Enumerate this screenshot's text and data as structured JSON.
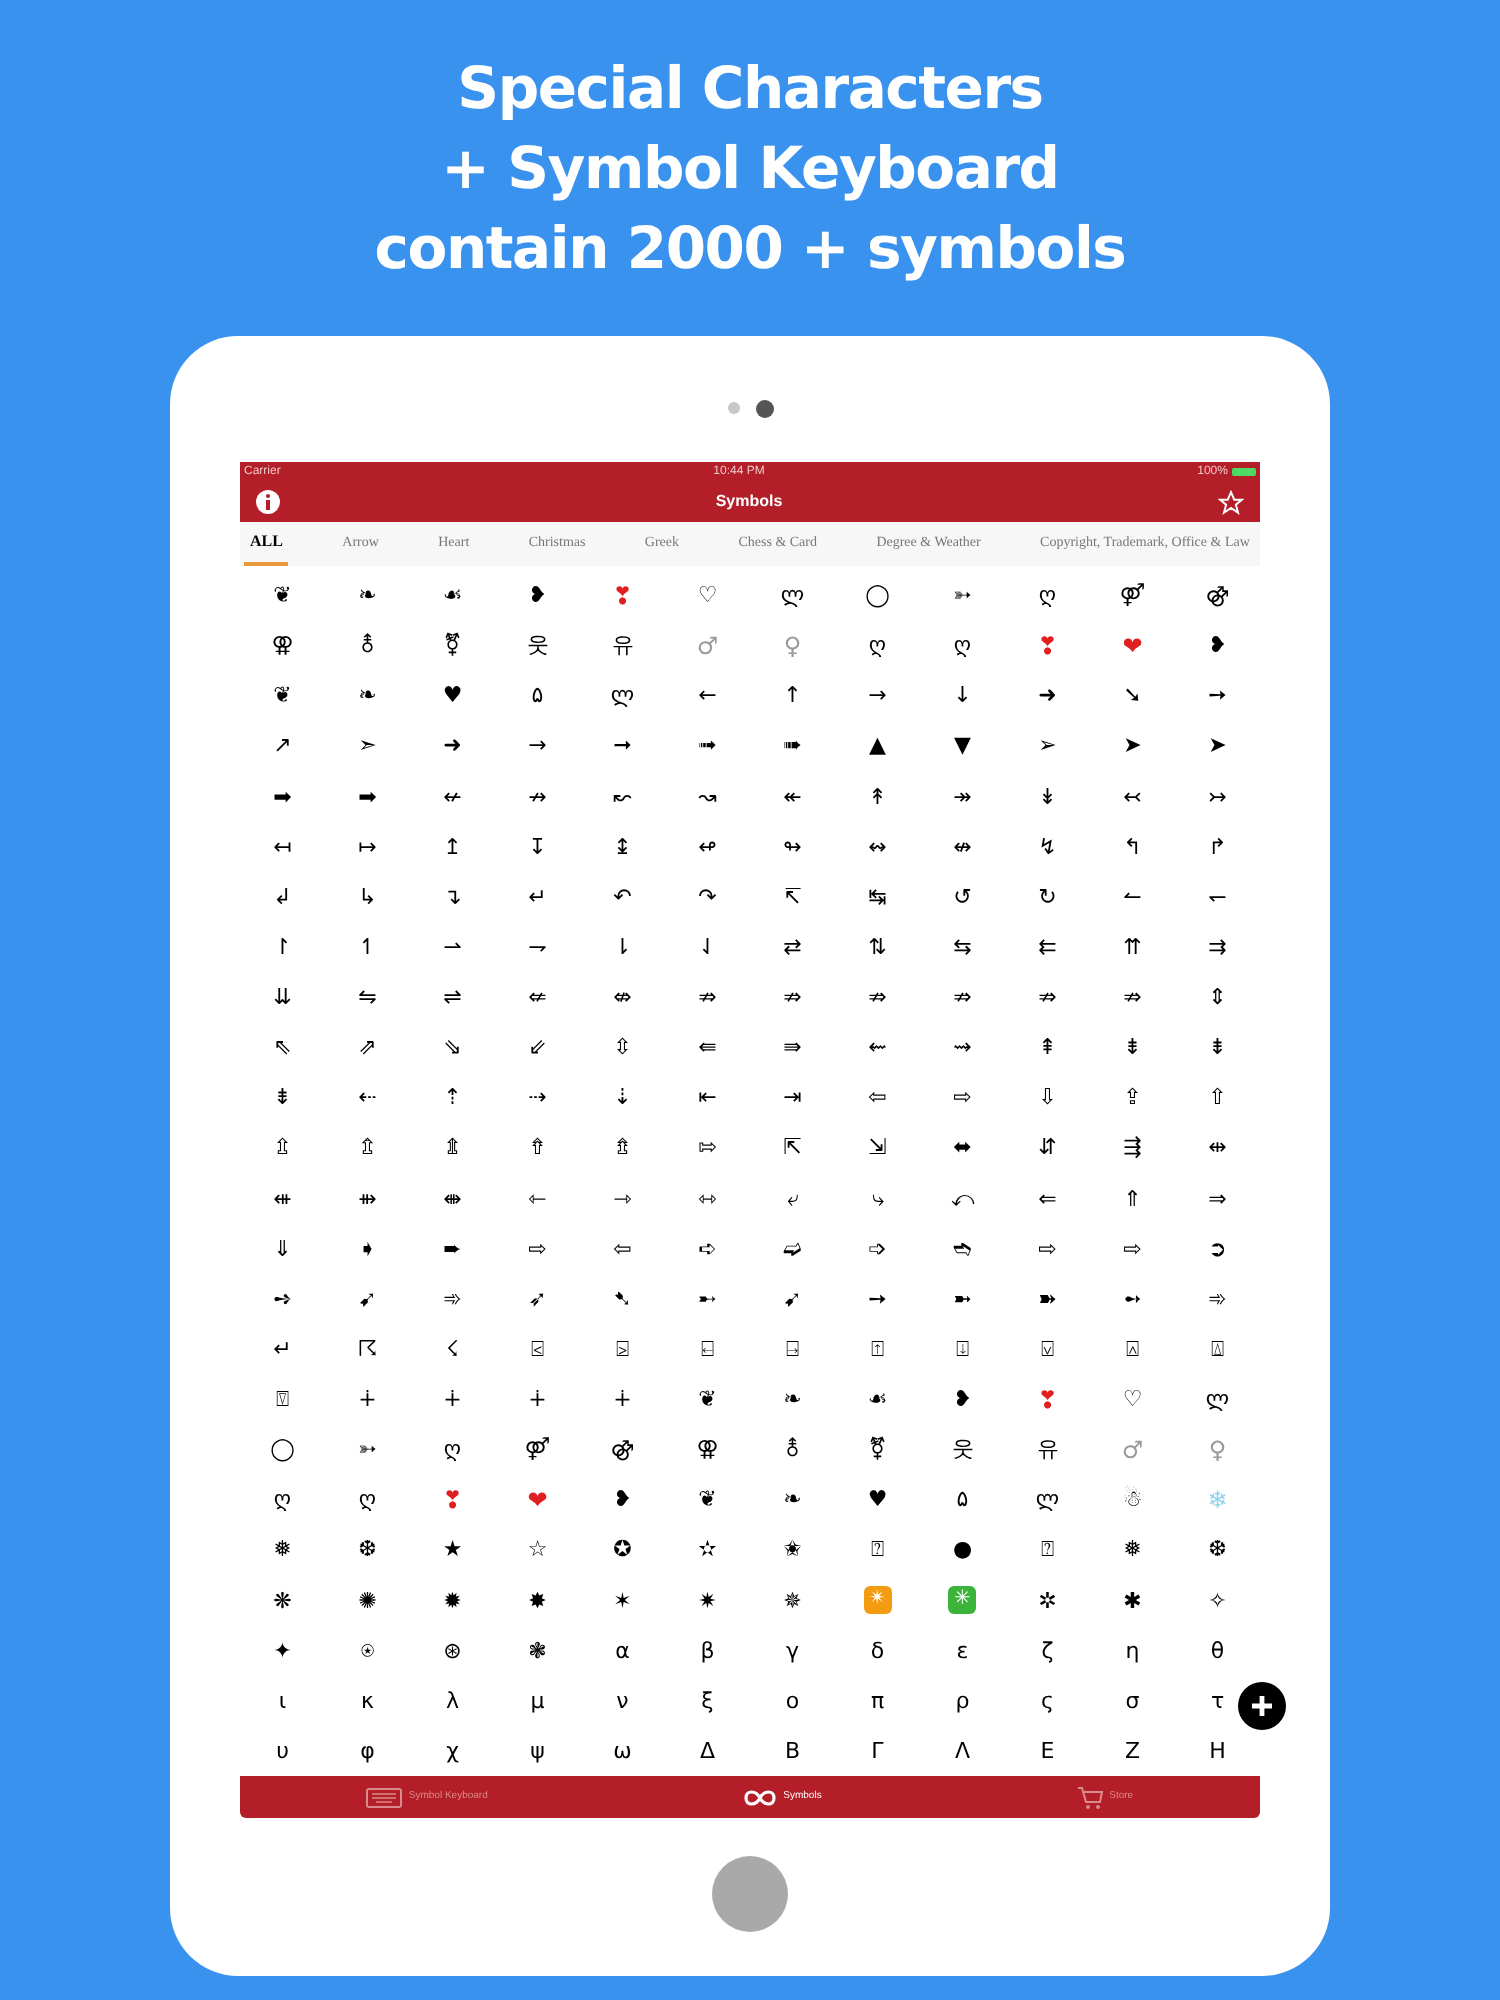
{
  "headline": [
    "Special Characters",
    "+ Symbol Keyboard",
    "contain 2000 + symbols"
  ],
  "page_dots": [
    {
      "selected": false
    },
    {
      "selected": true
    }
  ],
  "status_bar": {
    "carrier": "Carrier",
    "time": "10:44 PM",
    "battery": "100%"
  },
  "nav_bar": {
    "title": "Symbols"
  },
  "category_tabs": [
    {
      "label": "ALL",
      "selected": true
    },
    {
      "label": "Arrow",
      "selected": false
    },
    {
      "label": "Heart",
      "selected": false
    },
    {
      "label": "Christmas",
      "selected": false
    },
    {
      "label": "Greek",
      "selected": false
    },
    {
      "label": "Chess & Card",
      "selected": false
    },
    {
      "label": "Degree & Weather",
      "selected": false
    },
    {
      "label": "Copyright, Trademark, Office & Law",
      "selected": false
    }
  ],
  "symbols": [
    [
      "❦",
      "❧",
      "☙",
      "❥",
      {
        "char": "❣",
        "color": "#e02020"
      },
      "♡",
      "ლ",
      "◯",
      "➳",
      "ღ",
      "⚤",
      "⚣"
    ],
    [
      "⚢",
      "⚨",
      "⚧",
      "웃",
      "유",
      {
        "char": "♂",
        "color": "#9a9a9a"
      },
      {
        "char": "♀",
        "color": "#9a9a9a"
      },
      "ღ",
      "ღ",
      {
        "char": "❣",
        "color": "#e02020"
      },
      {
        "char": "❤",
        "color": "#e02020"
      },
      "❥"
    ],
    [
      "❦",
      "❧",
      "♥",
      "۵",
      "ლ",
      "←",
      "↑",
      "→",
      "↓",
      "➜",
      "➘",
      "➙"
    ],
    [
      "↗",
      "➣",
      "➜",
      "→",
      "➞",
      "➟",
      "➠",
      "▲",
      "▼",
      "➢",
      "➤",
      "➤"
    ],
    [
      "➡",
      "➡",
      "↚",
      "↛",
      "↜",
      "↝",
      "↞",
      "↟",
      "↠",
      "↡",
      "↢",
      "↣"
    ],
    [
      "↤",
      "↦",
      "↥",
      "↧",
      "↨",
      "↫",
      "↬",
      "↭",
      "↮",
      "↯",
      "↰",
      "↱"
    ],
    [
      "↲",
      "↳",
      "↴",
      "↵",
      "↶",
      "↷",
      "↸",
      "↹",
      "↺",
      "↻",
      "↼",
      "↽"
    ],
    [
      "↾",
      "↿",
      "⇀",
      "⇁",
      "⇂",
      "⇃",
      "⇄",
      "⇅",
      "⇆",
      "⇇",
      "⇈",
      "⇉"
    ],
    [
      "⇊",
      "⇋",
      "⇌",
      "⇍",
      "⇎",
      "⇏",
      "⇏",
      "⇏",
      "⇏",
      "⇏",
      "⇏",
      "⇕"
    ],
    [
      "⇖",
      "⇗",
      "⇘",
      "⇙",
      "⇳",
      "⇚",
      "⇛",
      "⇜",
      "⇝",
      "⇞",
      "⇟",
      "⇟"
    ],
    [
      "⇟",
      "⇠",
      "⇡",
      "⇢",
      "⇣",
      "⇤",
      "⇥",
      "⇦",
      "⇨",
      "⇩",
      "⇪",
      "⇧"
    ],
    [
      "⇫",
      "⇬",
      "⇭",
      "⇮",
      "⇯",
      "⇰",
      "⇱",
      "⇲",
      "⬌",
      "⇵",
      "⇶",
      "⇹"
    ],
    [
      "⇺",
      "⇻",
      "⇼",
      "⇽",
      "⇾",
      "⇿",
      "⤶",
      "⤷",
      "⤺",
      "⇐",
      "⇑",
      "⇒"
    ],
    [
      "⇓",
      "➧",
      "➨",
      "⇨",
      "⇦",
      "➪",
      "➫",
      "➩",
      "➬",
      "⇨",
      "⇨",
      "➲"
    ],
    [
      "➺",
      "➹",
      "➾",
      "➶",
      "➷",
      "➸",
      "➹",
      "➙",
      "➼",
      "➽",
      "➻",
      "➾"
    ],
    [
      "↵",
      "☈",
      "☇",
      "⍃",
      "⍄",
      "⍇",
      "⍈",
      "⍐",
      "⍗",
      "⍌",
      "⍓",
      "⍍"
    ],
    [
      "⍔",
      "∔",
      "∔",
      "∔",
      "∔",
      "❦",
      "❧",
      "☙",
      "❥",
      {
        "char": "❣",
        "color": "#e02020"
      },
      "♡",
      "ლ"
    ],
    [
      "◯",
      "➳",
      "ღ",
      "⚤",
      "⚣",
      "⚢",
      "⚨",
      "⚧",
      "웃",
      "유",
      {
        "char": "♂",
        "color": "#9a9a9a"
      },
      {
        "char": "♀",
        "color": "#9a9a9a"
      }
    ],
    [
      "ღ",
      "ღ",
      {
        "char": "❣",
        "color": "#e02020"
      },
      {
        "char": "❤",
        "color": "#e02020"
      },
      "❥",
      "❦",
      "❧",
      "♥",
      "۵",
      "ლ",
      "☃",
      {
        "char": "❄",
        "color": "#8fd3f0"
      }
    ],
    [
      "❅",
      "❆",
      "★",
      "☆",
      "✪",
      "✫",
      "✬",
      "⍰",
      "●",
      "⍰",
      "❅",
      "❆"
    ],
    [
      "❋",
      "✺",
      "✹",
      "✸",
      "✶",
      "✷",
      "✵",
      {
        "char": "✴",
        "kind": "tile",
        "color": "#f39c12"
      },
      {
        "char": "✳",
        "kind": "tile",
        "color": "#3cb43c"
      },
      "✲",
      "✱",
      "✧"
    ],
    [
      "✦",
      "⍟",
      "⊛",
      "❃",
      "α",
      "β",
      "γ",
      "δ",
      "ε",
      "ζ",
      "η",
      "θ"
    ],
    [
      "ι",
      "κ",
      "λ",
      "μ",
      "ν",
      "ξ",
      "ο",
      "π",
      "ρ",
      "ς",
      "σ",
      "τ"
    ],
    [
      "υ",
      "φ",
      "χ",
      "ψ",
      "ω",
      "Δ",
      "Β",
      "Γ",
      "Λ",
      "Ε",
      "Ζ",
      "Η"
    ]
  ],
  "tab_bar": [
    {
      "kind": "keyboard",
      "label": "Symbol Keyboard",
      "selected": false
    },
    {
      "kind": "infinity",
      "label": "Symbols",
      "selected": true
    },
    {
      "kind": "cart",
      "label": "Store",
      "selected": false
    }
  ]
}
